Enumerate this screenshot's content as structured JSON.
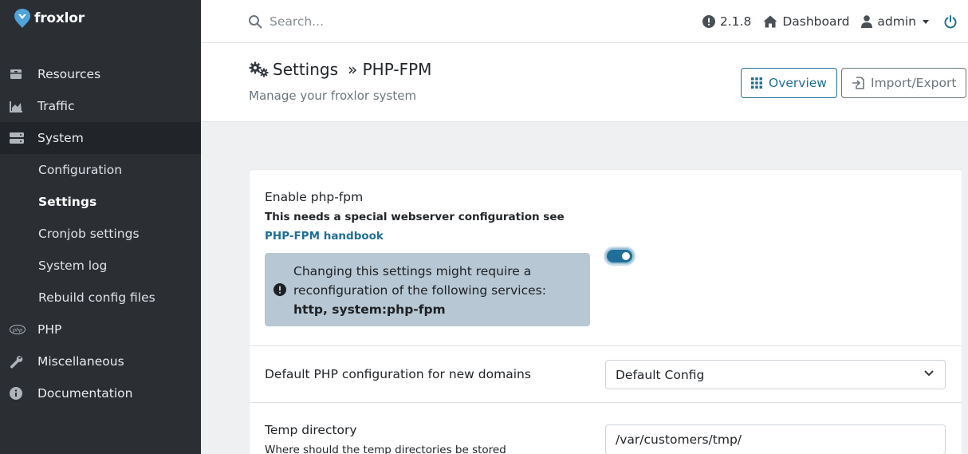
{
  "brand": {
    "name": "froxlor"
  },
  "sidebar": {
    "items": [
      {
        "label": "Resources",
        "icon": "layers-icon"
      },
      {
        "label": "Traffic",
        "icon": "chart-area-icon"
      },
      {
        "label": "System",
        "icon": "server-icon",
        "active": true
      },
      {
        "label": "PHP",
        "icon": "php-icon"
      },
      {
        "label": "Miscellaneous",
        "icon": "wrench-icon"
      },
      {
        "label": "Documentation",
        "icon": "info-circle-icon"
      }
    ],
    "system_sub": [
      {
        "label": "Configuration"
      },
      {
        "label": "Settings",
        "active": true
      },
      {
        "label": "Cronjob settings"
      },
      {
        "label": "System log"
      },
      {
        "label": "Rebuild config files"
      }
    ]
  },
  "topbar": {
    "search_placeholder": "Search...",
    "version": "2.1.8",
    "dashboard": "Dashboard",
    "user": "admin"
  },
  "header": {
    "title": "Settings",
    "crumb": "» PHP-FPM",
    "subtitle": "Manage your froxlor system",
    "overview_label": "Overview",
    "import_label": "Import/Export"
  },
  "settings": {
    "enable_fpm": {
      "label": "Enable php-fpm",
      "desc_prefix": "This needs a special webserver configuration see ",
      "desc_link": "PHP-FPM handbook",
      "alert_text": "Changing this settings might require a reconfiguration of the following services:",
      "alert_services": "http, system:php-fpm",
      "enabled": true
    },
    "default_config": {
      "label": "Default PHP configuration for new domains",
      "value": "Default Config"
    },
    "temp_dir": {
      "label": "Temp directory",
      "desc": "Where should the temp directories be stored",
      "value": "/var/customers/tmp/"
    }
  },
  "colors": {
    "accent": "#1f6f98",
    "sidebar_bg": "#2b2f34",
    "alert_bg": "#b7c7d3"
  }
}
